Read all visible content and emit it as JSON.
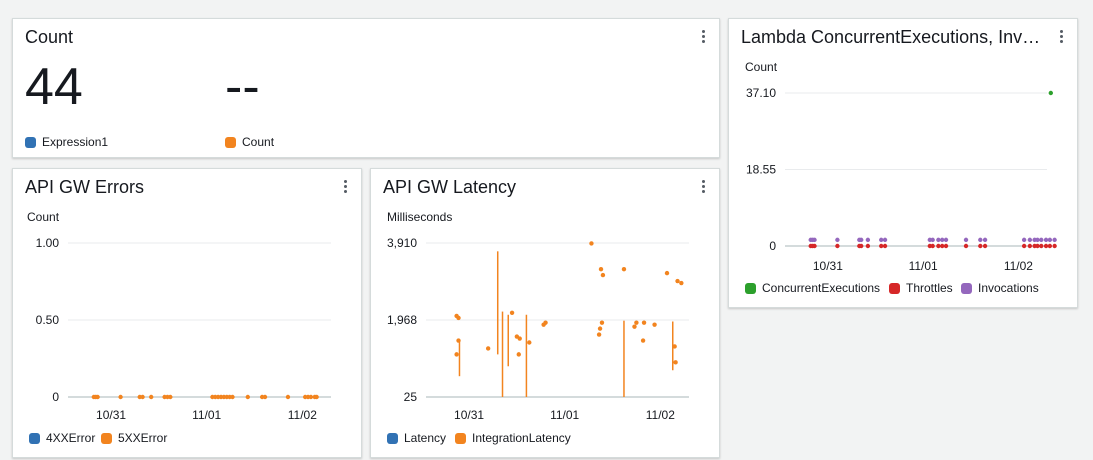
{
  "colors": {
    "blue": "#3172b4",
    "orange": "#f2841f",
    "green": "#2ca02c",
    "red": "#d62728",
    "purple": "#9467bd",
    "grid": "#e9ebed"
  },
  "widgets": {
    "count": {
      "title": "Count",
      "value_expression1": "44",
      "value_count": "--",
      "legend": [
        {
          "label": "Expression1",
          "color": "#3172b4"
        },
        {
          "label": "Count",
          "color": "#f2841f"
        }
      ]
    },
    "errors": {
      "title": "API GW Errors",
      "unit": "Count",
      "legend": [
        {
          "label": "4XXError",
          "color": "#3172b4"
        },
        {
          "label": "5XXError",
          "color": "#f2841f"
        }
      ]
    },
    "latency": {
      "title": "API GW Latency",
      "unit": "Milliseconds",
      "legend": [
        {
          "label": "Latency",
          "color": "#3172b4"
        },
        {
          "label": "IntegrationLatency",
          "color": "#f2841f"
        }
      ]
    },
    "lambda": {
      "title": "Lambda ConcurrentExecutions, Inv…",
      "unit": "Count",
      "legend": [
        {
          "label": "ConcurrentExecutions",
          "color": "#2ca02c"
        },
        {
          "label": "Throttles",
          "color": "#d62728"
        },
        {
          "label": "Invocations",
          "color": "#9467bd"
        }
      ]
    }
  },
  "chart_data": [
    {
      "id": "errors",
      "type": "scatter",
      "ylabel": "Count",
      "ylim": [
        0,
        1
      ],
      "yticks": [
        "1.00",
        "0.50",
        "0"
      ],
      "xrange": [
        30.55,
        33.0
      ],
      "xticks": [
        {
          "x": 31.0,
          "label": "10/31"
        },
        {
          "x": 32.0,
          "label": "11/01"
        },
        {
          "x": 33.0,
          "label": "11/02"
        }
      ],
      "series": [
        {
          "name": "4XXError",
          "color": "#3172b4",
          "points": []
        },
        {
          "name": "5XXError",
          "color": "#f2841f",
          "points": [
            [
              30.82,
              0
            ],
            [
              30.84,
              0
            ],
            [
              30.86,
              0
            ],
            [
              31.1,
              0
            ],
            [
              31.3,
              0
            ],
            [
              31.33,
              0
            ],
            [
              31.42,
              0
            ],
            [
              31.56,
              0
            ],
            [
              31.59,
              0
            ],
            [
              31.62,
              0
            ],
            [
              32.06,
              0
            ],
            [
              32.09,
              0
            ],
            [
              32.12,
              0
            ],
            [
              32.15,
              0
            ],
            [
              32.18,
              0
            ],
            [
              32.21,
              0
            ],
            [
              32.24,
              0
            ],
            [
              32.27,
              0
            ],
            [
              32.43,
              0
            ],
            [
              32.58,
              0
            ],
            [
              32.61,
              0
            ],
            [
              32.85,
              0
            ],
            [
              33.03,
              0
            ],
            [
              33.06,
              0
            ],
            [
              33.09,
              0
            ],
            [
              33.13,
              0
            ],
            [
              33.15,
              0
            ]
          ]
        }
      ]
    },
    {
      "id": "latency",
      "type": "scatter",
      "ylabel": "Milliseconds",
      "ylim": [
        25,
        3910
      ],
      "yticks": [
        "3,910",
        "1,968",
        "25"
      ],
      "xrange": [
        30.55,
        33.0
      ],
      "xticks": [
        {
          "x": 31.0,
          "label": "10/31"
        },
        {
          "x": 32.0,
          "label": "11/01"
        },
        {
          "x": 33.0,
          "label": "11/02"
        }
      ],
      "series": [
        {
          "name": "Latency",
          "color": "#3172b4",
          "points": []
        },
        {
          "name": "IntegrationLatency",
          "color": "#f2841f",
          "points": [
            [
              30.87,
              2070
            ],
            [
              30.89,
              2020
            ],
            [
              30.87,
              1100
            ],
            [
              30.89,
              1450
            ],
            [
              31.2,
              1250
            ],
            [
              31.45,
              2150
            ],
            [
              31.5,
              1550
            ],
            [
              31.52,
              1100
            ],
            [
              31.53,
              1500
            ],
            [
              31.63,
              1400
            ],
            [
              31.78,
              1850
            ],
            [
              31.8,
              1900
            ],
            [
              32.28,
              3900
            ],
            [
              32.38,
              3250
            ],
            [
              32.4,
              3100
            ],
            [
              32.37,
              1750
            ],
            [
              32.39,
              1900
            ],
            [
              32.36,
              1600
            ],
            [
              32.62,
              3250
            ],
            [
              32.73,
              1800
            ],
            [
              32.75,
              1900
            ],
            [
              32.82,
              1450
            ],
            [
              32.83,
              1900
            ],
            [
              32.94,
              1850
            ],
            [
              33.07,
              3150
            ],
            [
              33.15,
              1300
            ],
            [
              33.16,
              900
            ],
            [
              33.18,
              2950
            ],
            [
              33.22,
              2900
            ]
          ]
        }
      ]
    },
    {
      "id": "lambda",
      "type": "scatter",
      "ylabel": "Count",
      "ylim": [
        0,
        37.1
      ],
      "yticks": [
        "37.10",
        "18.55",
        "0"
      ],
      "xrange": [
        30.55,
        33.0
      ],
      "xticks": [
        {
          "x": 31.0,
          "label": "10/31"
        },
        {
          "x": 32.0,
          "label": "11/01"
        },
        {
          "x": 33.0,
          "label": "11/02"
        }
      ],
      "series": [
        {
          "name": "ConcurrentExecutions",
          "color": "#2ca02c",
          "points": [
            [
              33.34,
              37.1
            ]
          ]
        },
        {
          "name": "Throttles",
          "color": "#d62728",
          "points": [
            [
              30.82,
              0
            ],
            [
              30.84,
              0
            ],
            [
              30.86,
              0
            ],
            [
              31.1,
              0
            ],
            [
              31.33,
              0
            ],
            [
              31.35,
              0
            ],
            [
              31.42,
              0
            ],
            [
              31.56,
              0
            ],
            [
              31.6,
              0
            ],
            [
              32.07,
              0
            ],
            [
              32.1,
              0
            ],
            [
              32.16,
              0
            ],
            [
              32.2,
              0
            ],
            [
              32.24,
              0
            ],
            [
              32.45,
              0
            ],
            [
              32.6,
              0
            ],
            [
              32.65,
              0
            ],
            [
              33.06,
              0
            ],
            [
              33.12,
              0
            ],
            [
              33.17,
              0
            ],
            [
              33.2,
              0
            ],
            [
              33.24,
              0
            ],
            [
              33.29,
              0
            ],
            [
              33.33,
              0
            ],
            [
              33.38,
              0
            ]
          ]
        },
        {
          "name": "Invocations",
          "color": "#9467bd",
          "points": [
            [
              30.82,
              1
            ],
            [
              30.84,
              1
            ],
            [
              30.86,
              1
            ],
            [
              31.1,
              1
            ],
            [
              31.33,
              1
            ],
            [
              31.35,
              1
            ],
            [
              31.42,
              1
            ],
            [
              31.56,
              1
            ],
            [
              31.6,
              1
            ],
            [
              32.07,
              1
            ],
            [
              32.1,
              1
            ],
            [
              32.16,
              1
            ],
            [
              32.2,
              1
            ],
            [
              32.24,
              1
            ],
            [
              32.45,
              1
            ],
            [
              32.6,
              1
            ],
            [
              32.65,
              1
            ],
            [
              33.06,
              1
            ],
            [
              33.12,
              1
            ],
            [
              33.17,
              1
            ],
            [
              33.2,
              1
            ],
            [
              33.24,
              1
            ],
            [
              33.29,
              1
            ],
            [
              33.33,
              1
            ],
            [
              33.38,
              1
            ]
          ]
        }
      ]
    }
  ]
}
